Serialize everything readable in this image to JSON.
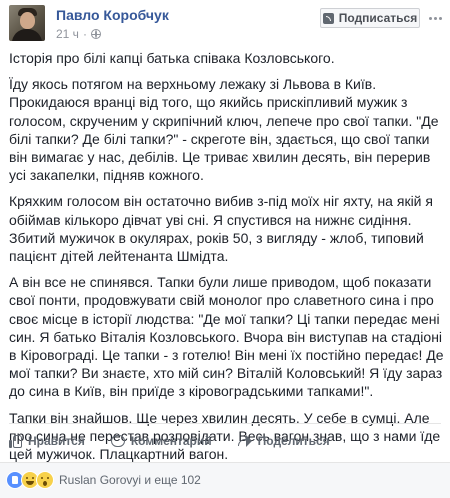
{
  "post": {
    "author": "Павло Коробчук",
    "time": "21 ч",
    "follow_label": "Подписаться",
    "paragraphs": [
      "Історія про білі капці батька співака Козловського.",
      "Їду якось потягом на верхньому лежаку зі Львова в Київ. Прокидаюся вранці від того, що якийсь прискіпливий мужик з голосом, скрученим у скрипічний ключ, лепече про свої тапки. \"Де білі тапки? Де білі тапки?\" - скреготе він, здається, що свої тапки він вимагає у нас, дебілів. Це триває хвилин десять, він перерив усі закапелки, підняв кожного.",
      "Кряхким голосом він остаточно вибив з-під моїх ніг яхту, на якій я обіймав кількоро дівчат уві сні. Я спустився на нижнє сидіння. Збитий мужичок в окулярах, років 50, з вигляду - жлоб, типовий пацієнт дітей лейтенанта Шмідта.",
      "А він все не спинявся. Тапки були лише приводом, щоб показати свої понти, продовжувати свій монолог про славетного сина і про своє місце в історії людства: \"Де мої тапки? Ці тапки передає мені син. Я батько Віталія Козловського. Вчора він виступав на стадіоні в Кіровограді. Це тапки - з готелю! Він мені їх постійно передає! Де мої тапки? Ви знаєте, хто мій син? Віталій Коловський! Я їду зараз до сина в Київ, він приїде з кіровоградськими тапками!\".",
      "Тапки він знайшов. Ще через хвилин десять. У себе в сумці. Але про сина не перестав розповідати. Весь вагон знав, що з нами їде цей мужичок. Плацкартний вагон."
    ]
  },
  "actions": {
    "like": "Нравится",
    "comment": "Комментарий",
    "share": "Поделиться"
  },
  "reactions": {
    "summary": "Ruslan Gorovyi и еще 102",
    "types": [
      "like",
      "haha",
      "wow"
    ]
  },
  "icons": {
    "privacy": "globe-icon",
    "follow": "rss-icon",
    "more": "more-options-icon",
    "like": "thumbs-up-icon",
    "comment": "comment-bubble-icon",
    "share": "share-arrow-icon"
  },
  "colors": {
    "link": "#365899",
    "text": "#1d2129",
    "muted": "#90949c",
    "action": "#606770"
  }
}
